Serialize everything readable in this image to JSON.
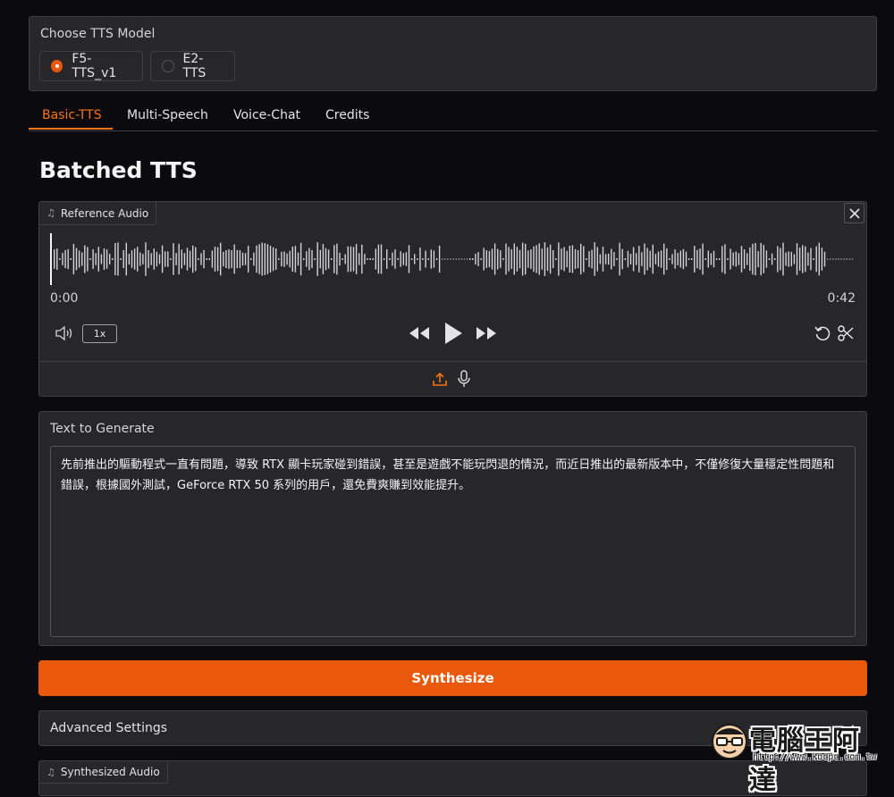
{
  "model_selector": {
    "label": "Choose TTS Model",
    "options": [
      {
        "label": "F5-TTS_v1",
        "selected": true
      },
      {
        "label": "E2-TTS",
        "selected": false
      }
    ]
  },
  "tabs": [
    {
      "label": "Basic-TTS",
      "active": true
    },
    {
      "label": "Multi-Speech",
      "active": false
    },
    {
      "label": "Voice-Chat",
      "active": false
    },
    {
      "label": "Credits",
      "active": false
    }
  ],
  "page_title": "Batched TTS",
  "reference_audio": {
    "label": "Reference Audio",
    "time_start": "0:00",
    "time_end": "0:42",
    "playback_rate": "1x",
    "playhead_fraction": 0
  },
  "text_to_generate": {
    "label": "Text to Generate",
    "value": "先前推出的驅動程式一直有問題，導致 RTX 顯卡玩家碰到錯誤，甚至是遊戲不能玩閃退的情況，而近日推出的最新版本中，不僅修復大量穩定性問題和錯誤，根據國外測試，GeForce RTX 50 系列的用戶，還免費爽賺到效能提升。"
  },
  "synthesize_button": "Synthesize",
  "advanced_settings": {
    "label": "Advanced Settings"
  },
  "synthesized_audio": {
    "label": "Synthesized Audio"
  },
  "watermark": {
    "text": "電腦王阿達",
    "url": "http://www.kocpc.com.tw"
  },
  "colors": {
    "accent": "#ea580c",
    "background": "#0b0b0f",
    "panel": "#27272a",
    "border": "#3f3f46"
  }
}
